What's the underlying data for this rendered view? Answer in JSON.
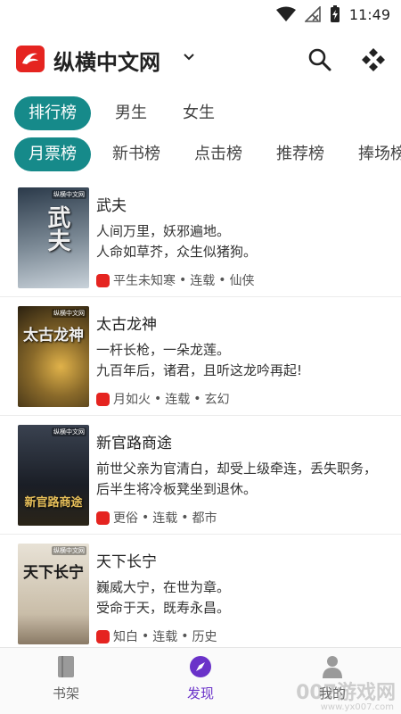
{
  "status_bar": {
    "time": "11:49"
  },
  "app_bar": {
    "title": "纵横中文网"
  },
  "primary_tabs": [
    {
      "label": "排行榜",
      "active": true
    },
    {
      "label": "男生",
      "active": false
    },
    {
      "label": "女生",
      "active": false
    }
  ],
  "secondary_tabs": [
    {
      "label": "月票榜",
      "active": true
    },
    {
      "label": "新书榜",
      "active": false
    },
    {
      "label": "点击榜",
      "active": false
    },
    {
      "label": "推荐榜",
      "active": false
    },
    {
      "label": "捧场榜",
      "active": false
    }
  ],
  "books": [
    {
      "title": "武夫",
      "desc": "人间万里，妖邪遍地。\n人命如草芥，众生似猪狗。",
      "author": "平生未知寒",
      "status": "连载",
      "genre": "仙侠",
      "cover_title": "武夫",
      "cover_colors": [
        "#2b3a4a",
        "#7c8a96",
        "#c9d2da"
      ]
    },
    {
      "title": "太古龙神",
      "desc": "一杆长枪，一朵龙莲。\n九百年后，诸君，且听这龙吟再起!",
      "author": "月如火",
      "status": "连载",
      "genre": "玄幻",
      "cover_title": "太古龙神",
      "cover_colors": [
        "#2a2010",
        "#8a6a2a",
        "#e0b24a"
      ]
    },
    {
      "title": "新官路商途",
      "desc": "前世父亲为官清白，却受上级牵连，丢失职务，后半生将冷板凳坐到退休。",
      "author": "更俗",
      "status": "连载",
      "genre": "都市",
      "cover_title": "新官路商途",
      "cover_colors": [
        "#1a1e26",
        "#3a4250",
        "#c99a2a"
      ]
    },
    {
      "title": "天下长宁",
      "desc": "巍威大宁，在世为章。\n受命于天，既寿永昌。",
      "author": "知白",
      "status": "连载",
      "genre": "历史",
      "cover_title": "天下长宁",
      "cover_colors": [
        "#e8e2d6",
        "#c9bda8",
        "#8a1e1e"
      ]
    }
  ],
  "cover_badge": "纵横中文网",
  "bottom_nav": [
    {
      "label": "书架",
      "icon": "book-icon",
      "active": false
    },
    {
      "label": "发现",
      "icon": "compass-icon",
      "active": true
    },
    {
      "label": "我的",
      "icon": "person-icon",
      "active": false
    }
  ],
  "watermark": {
    "text": "007游戏网",
    "sub": "www.yx007.com"
  },
  "colors": {
    "accent_teal": "#168a8a",
    "brand_red": "#e52420",
    "nav_active": "#6a32c9"
  }
}
